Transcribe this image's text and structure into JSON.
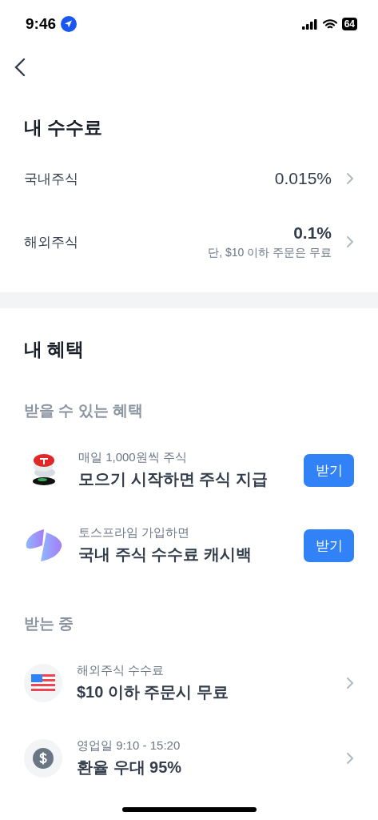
{
  "status_bar": {
    "time": "9:46",
    "battery": "64"
  },
  "fees": {
    "title": "내 수수료",
    "rows": [
      {
        "label": "국내주식",
        "value": "0.015%"
      },
      {
        "label": "해외주식",
        "value": "0.1%",
        "note": "단, $10 이하 주문은 무료"
      }
    ]
  },
  "benefits": {
    "title": "내 혜택",
    "available": {
      "heading": "받을 수 있는 혜택",
      "items": [
        {
          "kind": "coin-stack",
          "subtitle": "매일 1,000원씩 주식",
          "title": "모으기 시작하면 주식 지급",
          "button": "받기"
        },
        {
          "kind": "split-disc",
          "subtitle": "토스프라임 가입하면",
          "title": "국내 주식 수수료 캐시백",
          "button": "받기"
        }
      ]
    },
    "receiving": {
      "heading": "받는 중",
      "items": [
        {
          "kind": "flag",
          "subtitle": "해외주식 수수료",
          "title": "$10 이하 주문시 무료"
        },
        {
          "kind": "dollar",
          "subtitle": "영업일 9:10 - 15:20",
          "title": "환율 우대 95%"
        }
      ]
    }
  }
}
